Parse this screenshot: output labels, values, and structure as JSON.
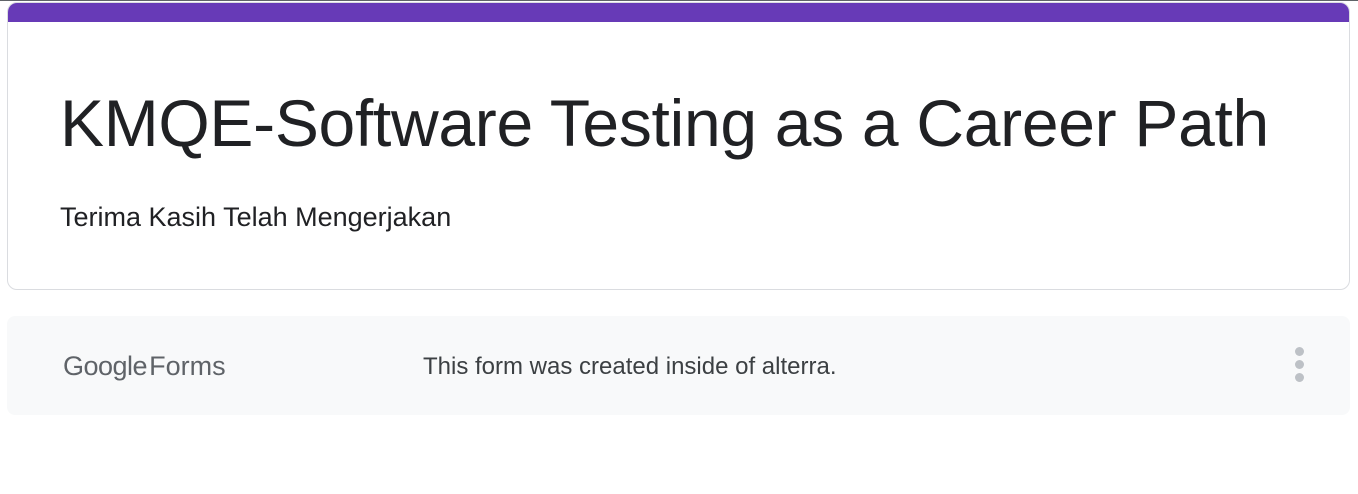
{
  "form": {
    "title": "KMQE-Software Testing as a Career Path",
    "confirmation_message": "Terima Kasih Telah Mengerjakan",
    "accent_color": "#673ab7"
  },
  "footer": {
    "brand_google": "Google",
    "brand_product": "Forms",
    "note": "This form was created inside of alterra.",
    "more_icon": "more-vert-icon"
  }
}
